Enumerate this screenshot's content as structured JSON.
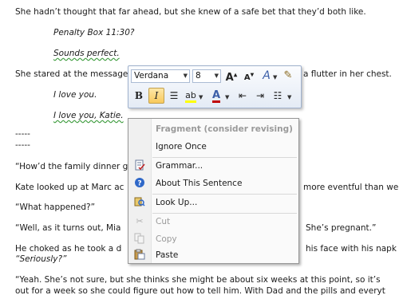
{
  "document": {
    "lines": [
      "She hadn’t thought that far ahead, but she knew of a safe bet that they’d both like.",
      "Penalty Box 11:30?",
      "Sounds perfect.",
      "She stared at the message",
      "a flutter in her chest.",
      "I love you.",
      "I love you, Katie.",
      "-----",
      "-----",
      "“How’d the family dinner g",
      "Kate looked up at Marc ac",
      "more eventful than we",
      "“What happened?”",
      "“Well, as it turns out, Mia",
      "She’s pregnant.”",
      "He choked as he took a d",
      "his face with his napk",
      "“Seriously?”",
      "“Yeah. She’s not sure, but she thinks she might be about six weeks at this point, so it’s",
      "out for a week so she could figure out how to tell him. With Dad and the pills and everyt"
    ]
  },
  "mini_toolbar": {
    "font_name": "Verdana",
    "font_size": "8",
    "grow_font_icon": "grow-font",
    "shrink_font_icon": "shrink-font",
    "bold_label": "B",
    "italic_label": "I",
    "italic_active": true
  },
  "context_menu": {
    "header": "Fragment (consider revising)",
    "items": [
      {
        "label": "Ignore Once",
        "enabled": true,
        "icon": null
      },
      {
        "label": "Grammar...",
        "enabled": true,
        "icon": "grammar-icon"
      },
      {
        "label": "About This Sentence",
        "enabled": true,
        "icon": "help-icon"
      },
      {
        "label": "Look Up...",
        "enabled": true,
        "icon": "research-icon"
      },
      {
        "label": "Cut",
        "enabled": false,
        "icon": "scissors-icon"
      },
      {
        "label": "Copy",
        "enabled": false,
        "icon": "copy-icon"
      },
      {
        "label": "Paste",
        "enabled": true,
        "icon": "paste-icon"
      }
    ]
  },
  "colors": {
    "highlight": "#ffff00",
    "font_color": "#c00000",
    "grammar_underline": "#3a9a3a"
  }
}
